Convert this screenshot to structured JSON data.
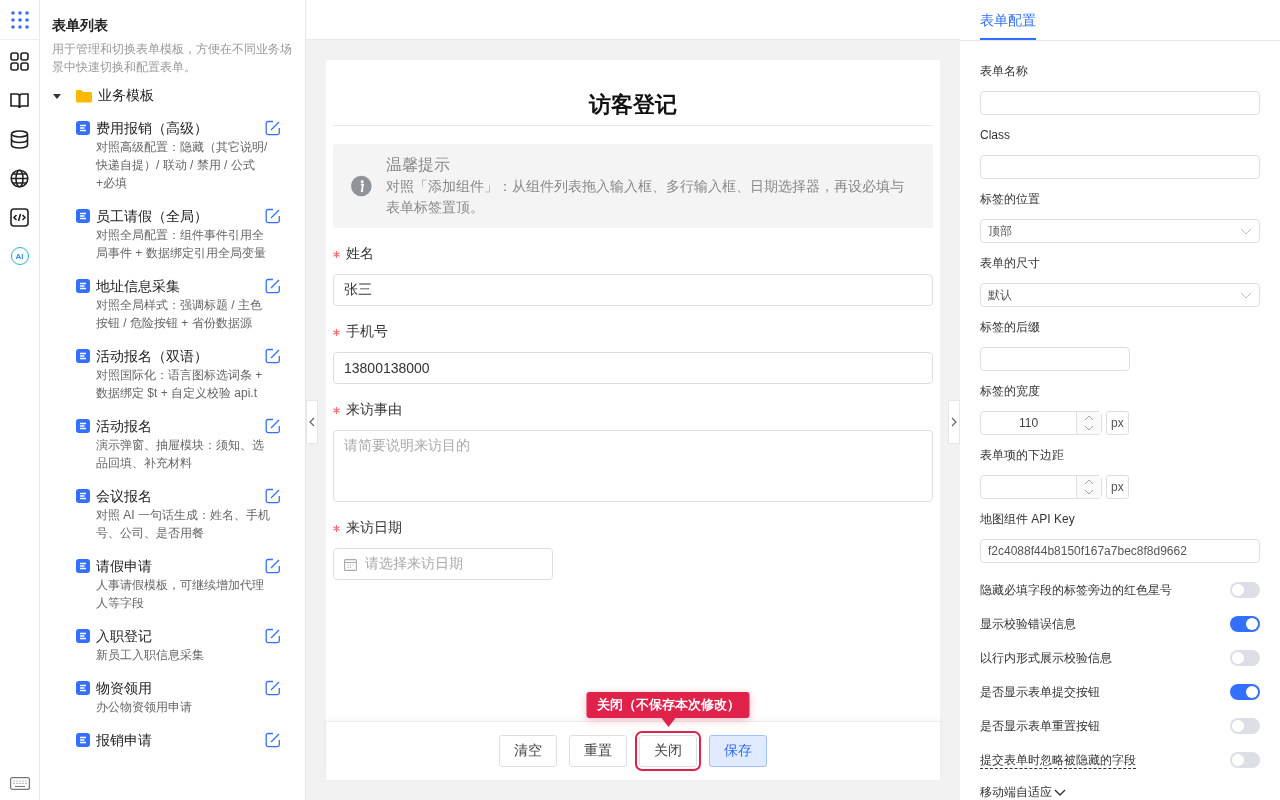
{
  "rail": {
    "ai_label": "AI"
  },
  "sidebar": {
    "title": "表单列表",
    "description": "用于管理和切换表单模板，方便在不同业务场景中快速切换和配置表单。",
    "folder": {
      "label": "业务模板",
      "expanded": true,
      "children": [
        {
          "title": "费用报销（高级）",
          "desc": "对照高级配置：隐藏（其它说明/快递自提）/ 联动 / 禁用 / 公式+必填"
        },
        {
          "title": "员工请假（全局）",
          "desc": "对照全局配置：组件事件引用全局事件 + 数据绑定引用全局变量"
        },
        {
          "title": "地址信息采集",
          "desc": "对照全局样式：强调标题 / 主色按钮 / 危险按钮 + 省份数据源"
        },
        {
          "title": "活动报名（双语）",
          "desc": "对照国际化：语言图标选词条 + 数据绑定 $t + 自定义校验 api.t"
        },
        {
          "title": "活动报名",
          "desc": "演示弹窗、抽屉模块：须知、选品回填、补充材料"
        },
        {
          "title": "会议报名",
          "desc": "对照 AI 一句话生成：姓名、手机号、公司、是否用餐"
        },
        {
          "title": "请假申请",
          "desc": "人事请假模板，可继续增加代理人等字段"
        },
        {
          "title": "入职登记",
          "desc": "新员工入职信息采集"
        },
        {
          "title": "物资领用",
          "desc": "办公物资领用申请"
        },
        {
          "title": "报销申请"
        }
      ]
    }
  },
  "form": {
    "title": "访客登记",
    "alert": {
      "title": "温馨提示",
      "text": "对照「添加组件」：从组件列表拖入输入框、多行输入框、日期选择器，再设必填与表单标签置顶。"
    },
    "fields": [
      {
        "kind": "input",
        "label": "姓名",
        "required": true,
        "value": "张三"
      },
      {
        "kind": "input",
        "label": "手机号",
        "required": true,
        "value": "13800138000"
      },
      {
        "kind": "textarea",
        "label": "来访事由",
        "required": true,
        "placeholder": "请简要说明来访目的"
      },
      {
        "kind": "date",
        "label": "来访日期",
        "required": true,
        "placeholder": "请选择来访日期"
      }
    ],
    "buttons": [
      {
        "label": "清空",
        "kind": "default",
        "highlighted": false
      },
      {
        "label": "重置",
        "kind": "default",
        "highlighted": false
      },
      {
        "label": "关闭",
        "kind": "default",
        "highlighted": true,
        "tooltip": "关闭（不保存本次修改）"
      },
      {
        "label": "保存",
        "kind": "primary",
        "highlighted": false
      }
    ]
  },
  "config": {
    "tabs": [
      {
        "label": "表单配置",
        "selected": true
      }
    ],
    "items": [
      {
        "kind": "text",
        "label": "表单名称"
      },
      {
        "kind": "text",
        "label": "Class"
      },
      {
        "kind": "select",
        "label": "标签的位置",
        "value": "顶部"
      },
      {
        "kind": "select",
        "label": "表单的尺寸",
        "value": "默认"
      },
      {
        "kind": "short",
        "label": "标签的后缀"
      },
      {
        "kind": "number",
        "label": "标签的宽度",
        "value": "110",
        "unit": "px"
      },
      {
        "kind": "number",
        "label": "表单项的下边距",
        "unit": "px"
      },
      {
        "kind": "text",
        "label": "地图组件 API Key",
        "value": "f2c4088f44b8150f167a7bec8f8d9662"
      },
      {
        "kind": "switch",
        "label": "隐藏必填字段的标签旁边的红色星号",
        "on": false,
        "help": false
      },
      {
        "kind": "switch",
        "label": "显示校验错误信息",
        "on": true,
        "help": false
      },
      {
        "kind": "switch",
        "label": "以行内形式展示校验信息",
        "on": false,
        "help": false
      },
      {
        "kind": "switch",
        "label": "是否显示表单提交按钮",
        "on": true,
        "help": false
      },
      {
        "kind": "switch",
        "label": "是否显示表单重置按钮",
        "on": false,
        "help": false
      },
      {
        "kind": "switch",
        "label": "提交表单时忽略被隐藏的字段",
        "on": false,
        "help": true
      },
      {
        "kind": "collapse",
        "label": "移动端自适应"
      }
    ]
  }
}
